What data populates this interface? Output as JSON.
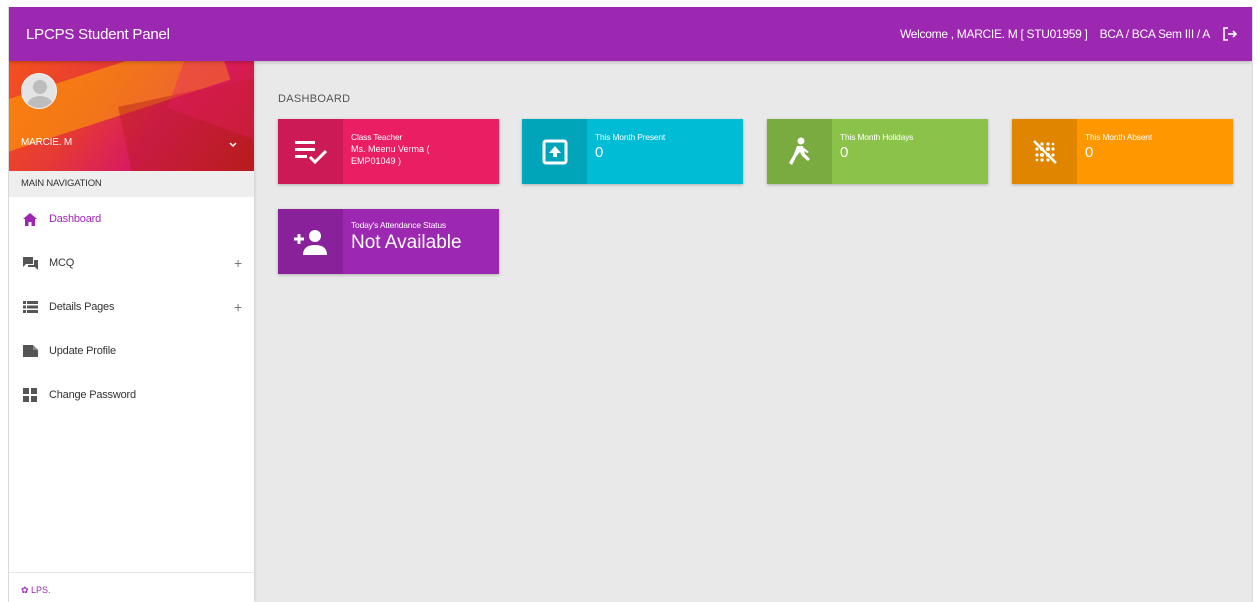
{
  "header": {
    "brand": "LPCPS Student Panel",
    "welcome": "Welcome , MARCIE. M [ STU01959 ]",
    "course": "BCA / BCA Sem III / A",
    "logout_icon": "logout-icon"
  },
  "sidebar": {
    "user_name": "MARCIE. M",
    "nav_header": "MAIN NAVIGATION",
    "items": [
      {
        "label": "Dashboard",
        "icon": "home-icon"
      },
      {
        "label": "MCQ",
        "icon": "chat-icon",
        "expand": "+"
      },
      {
        "label": "Details Pages",
        "icon": "list-icon",
        "expand": "+"
      },
      {
        "label": "Update Profile",
        "icon": "folder-icon"
      },
      {
        "label": "Change Password",
        "icon": "grid-icon"
      }
    ],
    "footer": "LPS."
  },
  "main": {
    "title": "DASHBOARD",
    "cards": [
      {
        "label": "Class Teacher",
        "value": "Ms. Meenu Verma ( EMP01049 )",
        "color": "#e91e63",
        "icon": "playlist-check-icon"
      },
      {
        "label": "This Month Present",
        "value": "0",
        "color": "#00bcd4",
        "icon": "upload-box-icon"
      },
      {
        "label": "This Month Holidays",
        "value": "0",
        "color": "#8bc34a",
        "icon": "walking-person-icon"
      },
      {
        "label": "This Month Absent",
        "value": "0",
        "color": "#ff9800",
        "icon": "blur-off-icon"
      },
      {
        "label": "Today's Attendance Status",
        "value": "Not Available",
        "color": "#9c27b0",
        "icon": "person-add-icon"
      }
    ]
  },
  "colors": {
    "accent": "#9c27b0",
    "background": "#e9e9e9"
  }
}
